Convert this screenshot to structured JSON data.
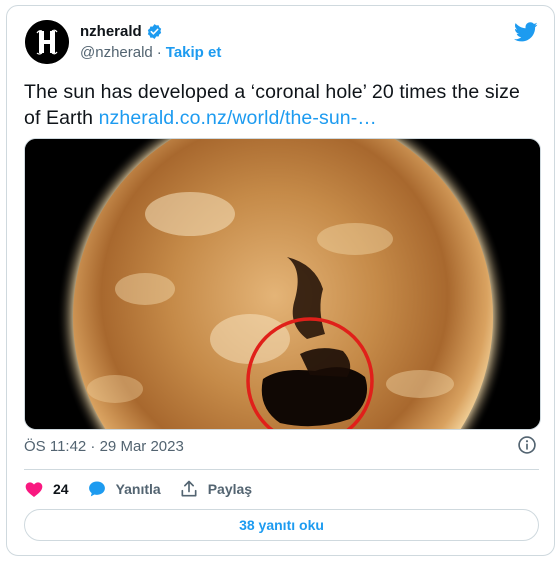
{
  "author": {
    "name": "nzherald",
    "handle": "@nzherald",
    "separator": "·",
    "follow_label": "Takip et"
  },
  "tweet": {
    "text": "The sun has developed a ‘coronal hole’ 20 times the size of Earth ",
    "link": "nzherald.co.nz/world/the-sun-…"
  },
  "meta": {
    "timestamp": "ÖS 11:42 · 29 Mar 2023"
  },
  "actions": {
    "like_count": "24",
    "reply_label": "Yanıtla",
    "share_label": "Paylaş"
  },
  "replies_button": {
    "label": "38 yanıtı oku"
  },
  "colors": {
    "accent": "#1d9bf0",
    "like": "#f91880",
    "muted": "#536471",
    "highlight_circle": "#e0201a"
  },
  "icons": [
    "nzherald-logo-icon",
    "verified-badge-icon",
    "twitter-bird-icon",
    "info-icon",
    "heart-icon",
    "reply-bubble-icon",
    "share-icon"
  ]
}
